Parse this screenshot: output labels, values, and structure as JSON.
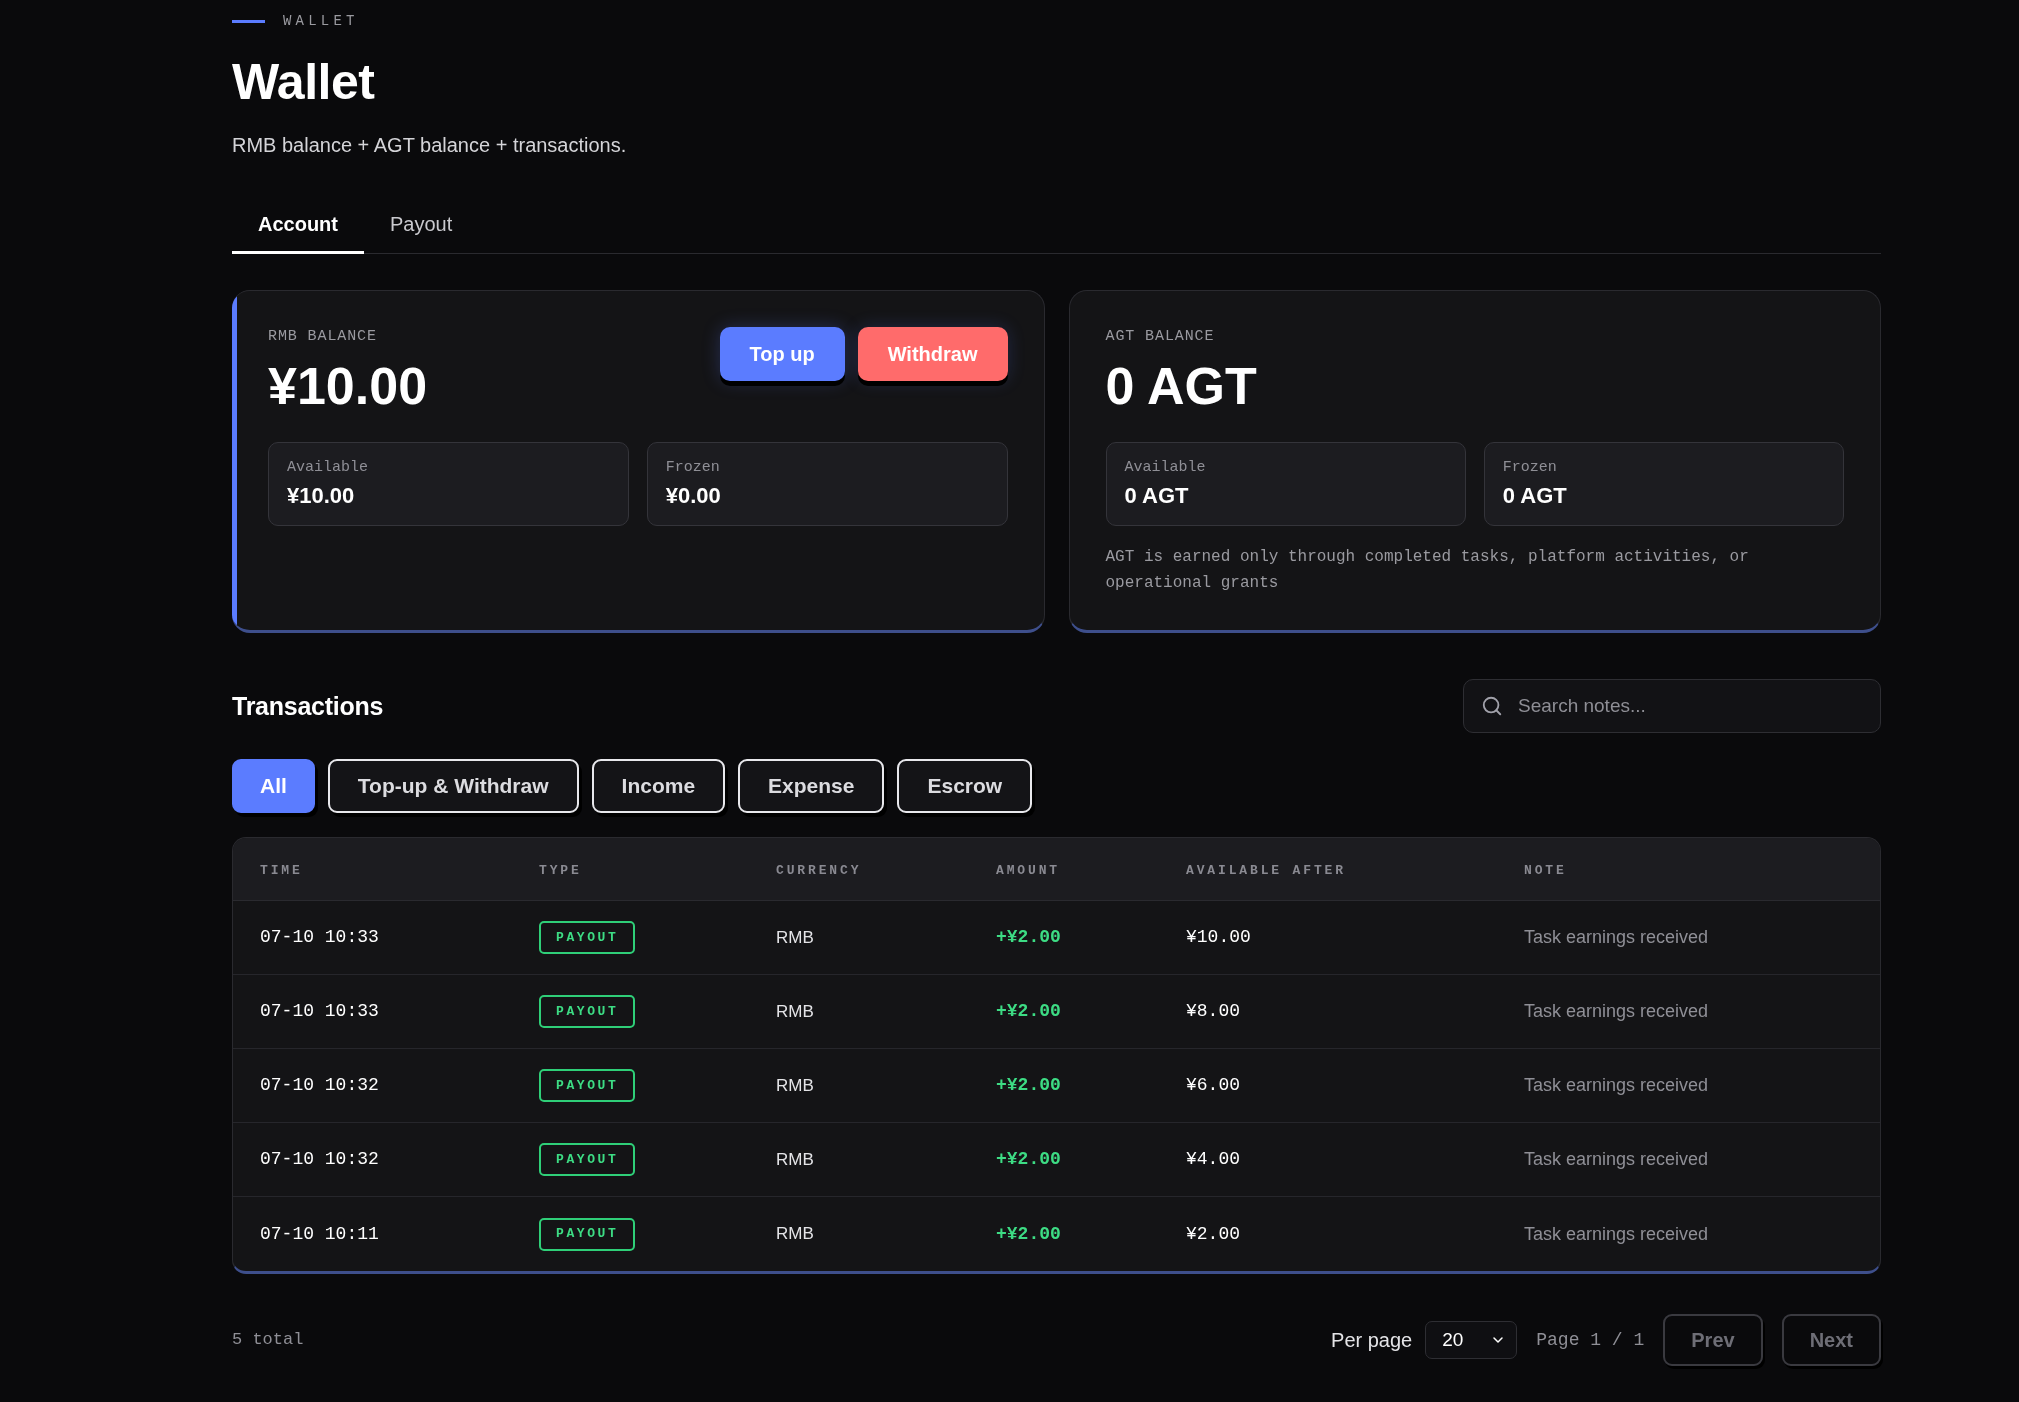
{
  "header": {
    "eyebrow": "WALLET",
    "title": "Wallet",
    "subtitle": "RMB balance + AGT balance + transactions."
  },
  "tabs": [
    {
      "label": "Account",
      "selected": true
    },
    {
      "label": "Payout",
      "selected": false
    }
  ],
  "balances": [
    {
      "label": "RMB BALANCE",
      "amount": "¥10.00",
      "highlighted": true,
      "actions": [
        {
          "label": "Top up",
          "kind": "topup"
        },
        {
          "label": "Withdraw",
          "kind": "withdraw"
        }
      ],
      "breakdown": [
        {
          "label": "Available",
          "value": "¥10.00"
        },
        {
          "label": "Frozen",
          "value": "¥0.00"
        }
      ]
    },
    {
      "label": "AGT BALANCE",
      "amount": "0 AGT",
      "highlighted": false,
      "breakdown": [
        {
          "label": "Available",
          "value": "0 AGT"
        },
        {
          "label": "Frozen",
          "value": "0 AGT"
        }
      ],
      "note": "AGT is earned only through completed tasks, platform activities, or operational grants"
    }
  ],
  "transactions": {
    "title": "Transactions",
    "search": {
      "placeholder": "Search notes..."
    },
    "filters": [
      {
        "label": "All",
        "selected": true
      },
      {
        "label": "Top-up & Withdraw",
        "selected": false
      },
      {
        "label": "Income",
        "selected": false
      },
      {
        "label": "Expense",
        "selected": false
      },
      {
        "label": "Escrow",
        "selected": false
      }
    ],
    "table": {
      "columns": [
        "TIME",
        "TYPE",
        "CURRENCY",
        "AMOUNT",
        "AVAILABLE AFTER",
        "NOTE"
      ],
      "rows": [
        {
          "time": "07-10 10:33",
          "type": "PAYOUT",
          "currency": "RMB",
          "amount": "+¥2.00",
          "available_after": "¥10.00",
          "note": "Task earnings received"
        },
        {
          "time": "07-10 10:33",
          "type": "PAYOUT",
          "currency": "RMB",
          "amount": "+¥2.00",
          "available_after": "¥8.00",
          "note": "Task earnings received"
        },
        {
          "time": "07-10 10:32",
          "type": "PAYOUT",
          "currency": "RMB",
          "amount": "+¥2.00",
          "available_after": "¥6.00",
          "note": "Task earnings received"
        },
        {
          "time": "07-10 10:32",
          "type": "PAYOUT",
          "currency": "RMB",
          "amount": "+¥2.00",
          "available_after": "¥4.00",
          "note": "Task earnings received"
        },
        {
          "time": "07-10 10:11",
          "type": "PAYOUT",
          "currency": "RMB",
          "amount": "+¥2.00",
          "available_after": "¥2.00",
          "note": "Task earnings received"
        }
      ]
    }
  },
  "pagination": {
    "total": "5 total",
    "per_page_label": "Per page",
    "per_page": "20",
    "page": "Page 1 / 1",
    "buttons": [
      {
        "label": "Prev",
        "disabled": true
      },
      {
        "label": "Next",
        "disabled": true
      }
    ]
  }
}
